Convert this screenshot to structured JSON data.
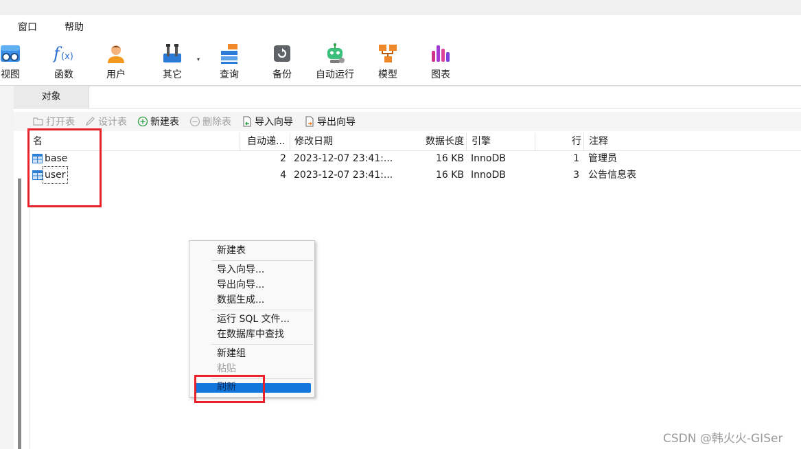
{
  "menubar": {
    "items": [
      "窗口",
      "帮助"
    ]
  },
  "toolbar": {
    "buttons": [
      {
        "label": "视图",
        "icon": "view-icon"
      },
      {
        "label": "函数",
        "icon": "function-icon"
      },
      {
        "label": "用户",
        "icon": "user-icon"
      },
      {
        "label": "其它",
        "icon": "tools-icon"
      },
      {
        "label": "查询",
        "icon": "query-icon"
      },
      {
        "label": "备份",
        "icon": "backup-icon"
      },
      {
        "label": "自动运行",
        "icon": "robot-icon"
      },
      {
        "label": "模型",
        "icon": "model-icon"
      },
      {
        "label": "图表",
        "icon": "chart-icon"
      }
    ],
    "dropdown_caret": "▾"
  },
  "tabs": {
    "objects": "对象"
  },
  "object_toolbar": {
    "open_table": "打开表",
    "design_table": "设计表",
    "new_table": "新建表",
    "delete_table": "删除表",
    "import_wizard": "导入向导",
    "export_wizard": "导出向导"
  },
  "table": {
    "columns": {
      "name": "名",
      "auto_increment": "自动递...",
      "modified": "修改日期",
      "data_length": "数据长度",
      "engine": "引擎",
      "rows": "行",
      "comment": "注释"
    },
    "rows": [
      {
        "name": "base",
        "auto_increment": "2",
        "modified": "2023-12-07 23:41:...",
        "data_length": "16 KB",
        "engine": "InnoDB",
        "rows": "1",
        "comment": "管理员"
      },
      {
        "name": "user",
        "auto_increment": "4",
        "modified": "2023-12-07 23:41:...",
        "data_length": "16 KB",
        "engine": "InnoDB",
        "rows": "3",
        "comment": "公告信息表"
      }
    ]
  },
  "context_menu": {
    "new_table": "新建表",
    "import_wizard": "导入向导...",
    "export_wizard": "导出向导...",
    "data_generation": "数据生成...",
    "run_sql_file": "运行 SQL 文件...",
    "find_in_database": "在数据库中查找",
    "new_group": "新建组",
    "paste": "粘贴",
    "refresh": "刷新"
  },
  "watermark": "CSDN @韩火火-GISer",
  "colors": {
    "highlight": "#e8212b",
    "selection": "#1177dd",
    "new_icon": "#2ea043"
  }
}
